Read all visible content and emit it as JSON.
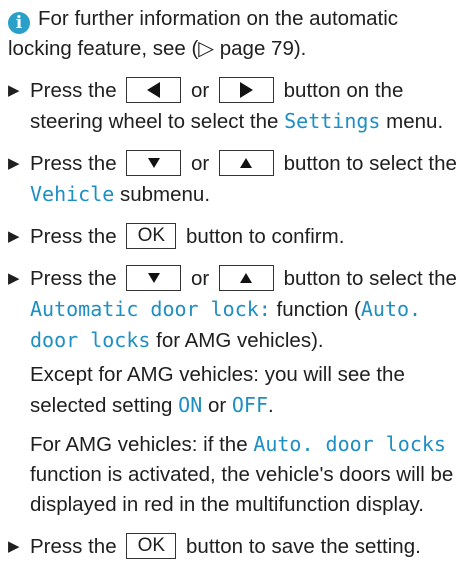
{
  "info": {
    "icon": "info-icon",
    "line1": "For further information on the automatic",
    "line2": "locking feature, see (▷ page 79)."
  },
  "steps": {
    "s1": {
      "a": "Press the",
      "or": "or",
      "b": "button on the steering wheel to select the",
      "menu": "Settings",
      "c": "menu."
    },
    "s2": {
      "a": "Press the",
      "or": "or",
      "b": "button to select the",
      "submenu": "Vehicle",
      "c": "submenu."
    },
    "s3": {
      "a": "Press the",
      "ok": "OK",
      "b": "button to confirm."
    },
    "s4": {
      "a": "Press the",
      "or": "or",
      "b": "button to select the",
      "function": "Automatic door lock:",
      "c": "function (",
      "amg_func": "Auto. door locks",
      "d": "for AMG vehicles).",
      "note1_a": "Except for AMG vehicles: you will see the selected setting",
      "on": "ON",
      "note1_or": "or",
      "off": "OFF",
      "note1_end": ".",
      "note2_a": "For AMG vehicles: if the",
      "note2_func": "Auto. door locks",
      "note2_b": "function is activated, the vehicle's doors will be displayed in red in the multifunction display."
    },
    "s5": {
      "a": "Press the",
      "ok": "OK",
      "b": "button to save the setting."
    }
  },
  "colors": {
    "accent": "#1e8fc2",
    "info": "#2aa0c8"
  }
}
